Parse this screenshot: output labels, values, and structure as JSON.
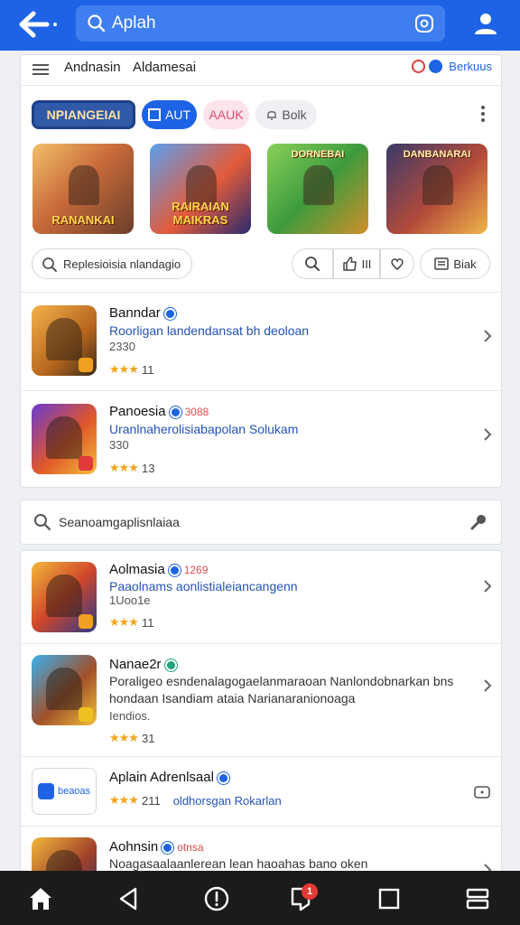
{
  "topbar": {
    "search_text": "Aplah",
    "colors": {
      "bar": "#1e63e6",
      "search_field": "#3f7ef0"
    }
  },
  "subheader": {
    "nav_1": "Andnasin",
    "nav_2": "Aldamesai",
    "right_label": "Berkuus"
  },
  "chips": [
    {
      "label": "NPIANGEIAI"
    },
    {
      "label": "AUT"
    },
    {
      "label": "AAUK"
    },
    {
      "label": "Bolk"
    }
  ],
  "thumbnails": [
    {
      "top": "",
      "label": "RANANKAI"
    },
    {
      "top": "",
      "label": "RAIRAIAN MAIKRAS"
    },
    {
      "top": "DORNEBAI",
      "label": ""
    },
    {
      "top": "DANBANARAI",
      "label": ""
    }
  ],
  "filters": {
    "search_pill": "Replesioisia nlandagio",
    "like_label": "III",
    "list_label": "Biak"
  },
  "top_apps": [
    {
      "name": "Banndar",
      "tag": "",
      "desc": "Roorligan landendansat bh deoloan",
      "sub": "2330",
      "stars": "★★★",
      "rating": "11"
    },
    {
      "name": "Panoesia",
      "tag": "3088",
      "desc": "Uranlnaherolisiabapolan Solukam",
      "sub": "330",
      "stars": "★★★",
      "rating": "13"
    }
  ],
  "secondary_search": {
    "placeholder": "Seanoamgaplisnlaiaa"
  },
  "more_apps": [
    {
      "name": "Aolmasia",
      "tag": "1269",
      "desc": "Paaolnams aonlistialeiancangenn",
      "sub": "1Uoo1e",
      "stars": "★★★",
      "rating": "11"
    },
    {
      "name": "Nanae2r",
      "tag": "",
      "desc": "Poraligeo esndenalagogaelanmaraoan Nanlondobnarkan bns hondaan  Isandiam ataia Narianaranionoaga",
      "sub": "Iendios.",
      "stars": "★★★",
      "rating": "31"
    },
    {
      "name": "Aplain Adrenlsaal",
      "tag": "",
      "logo_text": "beaoas",
      "desc": "oldhorsgan Rokarlan",
      "stars": "★★★",
      "rating": "211"
    },
    {
      "name": "Aohnsin",
      "tag": "otnsa",
      "desc": "Noagasaalaanlerean lean haoahas bano oken"
    }
  ],
  "bottom_nav": {
    "badge_count": "1",
    "bg": "#1b1b1b"
  }
}
